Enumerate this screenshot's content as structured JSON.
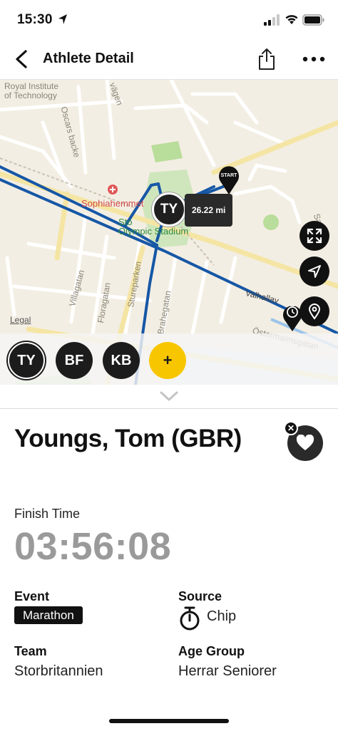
{
  "status_bar": {
    "time": "15:30"
  },
  "nav": {
    "title": "Athlete Detail"
  },
  "map": {
    "labels": {
      "royal": "Royal Institute\nof Technology",
      "oscars": "Oscars backe",
      "vagen": "vägen",
      "sophia": "Sophiahemmet",
      "stadium": "Sto\nOlympic Stadium",
      "villa": "Villagatan",
      "flora": "Floragatan",
      "sture": "Stureparken",
      "brahe": "Brahegatan",
      "valhall": "Valhallav",
      "oster": "Östermalmsgatan",
      "sand": "Sand"
    },
    "legal": "Legal",
    "athlete_marker": "TY",
    "distance": "26.22 mi",
    "start_label": "START",
    "route_color": "#1657a6"
  },
  "athletes": {
    "chips": [
      "TY",
      "BF",
      "KB"
    ],
    "add_label": "+"
  },
  "athlete": {
    "name": "Youngs, Tom (GBR)",
    "finish_time_label": "Finish Time",
    "finish_time": "03:56:08",
    "event_label": "Event",
    "event": "Marathon",
    "source_label": "Source",
    "source": "Chip",
    "team_label": "Team",
    "team": "Storbritannien",
    "age_group_label": "Age Group",
    "age_group": "Herrar Seniorer"
  },
  "icons": {
    "back": "chevron-left-icon",
    "share": "share-icon",
    "more": "more-icon",
    "expand": "expand-icon",
    "locate": "navigation-arrow-icon",
    "pin": "location-pin-icon",
    "favorite": "heart-icon",
    "source": "stopwatch-icon"
  },
  "colors": {
    "accent_yellow": "#f8c600",
    "dark": "#1c1c1c",
    "time_gray": "#9a9a9a"
  }
}
